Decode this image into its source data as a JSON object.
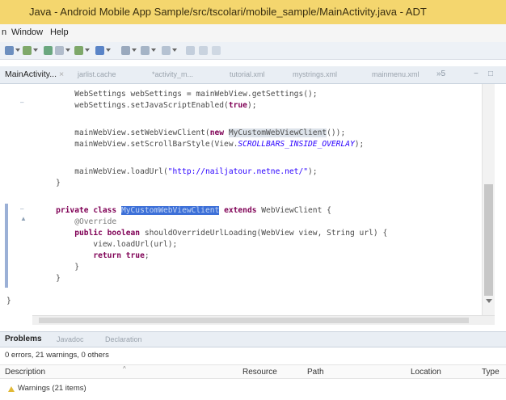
{
  "window": {
    "title": "Java - Android Mobile App Sample/src/tscolari/mobile_sample/MainActivity.java - ADT"
  },
  "menu": {
    "items": [
      "n",
      "Window",
      "Help"
    ]
  },
  "editor_tabs": [
    {
      "label": "MainActivity...",
      "active": true
    },
    {
      "label": "jarlist.cache",
      "active": false
    },
    {
      "label": "*activity_m...",
      "active": false
    },
    {
      "label": "tutorial.xml",
      "active": false
    },
    {
      "label": "mystrings.xml",
      "active": false
    },
    {
      "label": "mainmenu.xml",
      "active": false
    }
  ],
  "editor_tab_overflow": "»5",
  "code": {
    "l1": "        WebSettings webSettings = mainWebView.getSettings();",
    "l2a": "        webSettings.setJavaScriptEnabled(",
    "l2b": "true",
    "l2c": ");",
    "l3a": "        mainWebView.setWebViewClient(",
    "l3b": "new",
    "l3c": " ",
    "l3d": "MyCustomWebViewClient",
    "l3e": "());",
    "l4a": "        mainWebView.setScrollBarStyle(View.",
    "l4b": "SCROLLBARS_INSIDE_OVERLAY",
    "l4c": ");",
    "l5a": "        mainWebView.loadUrl(",
    "l5b": "\"http://nailjatour.netne.net/\"",
    "l5c": ");",
    "l6": "    }",
    "l7a": "    ",
    "l7b": "private class",
    "l7c": " ",
    "l7d": "MyCustomWebViewClient",
    "l7e": " ",
    "l7f": "extends",
    "l7g": " WebViewClient {",
    "l8": "        @Override",
    "l9a": "        ",
    "l9b": "public boolean",
    "l9c": " shouldOverrideUrlLoading(WebView view, String url) {",
    "l10": "            view.loadUrl(url);",
    "l11a": "            ",
    "l11b": "return true",
    "l11c": ";",
    "l12": "        }",
    "l13": "    }",
    "l14": "}"
  },
  "bottom_tabs": [
    {
      "label": "Problems",
      "active": true
    },
    {
      "label": "Javadoc",
      "active": false
    },
    {
      "label": "Declaration",
      "active": false
    }
  ],
  "problems": {
    "summary": "0 errors, 21 warnings, 0 others",
    "columns": [
      "Description",
      "Resource",
      "Path",
      "Location",
      "Type"
    ],
    "rows": [
      {
        "label": "Warnings (21 items)"
      }
    ]
  },
  "colors": {
    "titlebar": "#f4d66e",
    "keyword": "#7f0055",
    "selection": "#3d70d8",
    "string": "#2a00ff"
  }
}
